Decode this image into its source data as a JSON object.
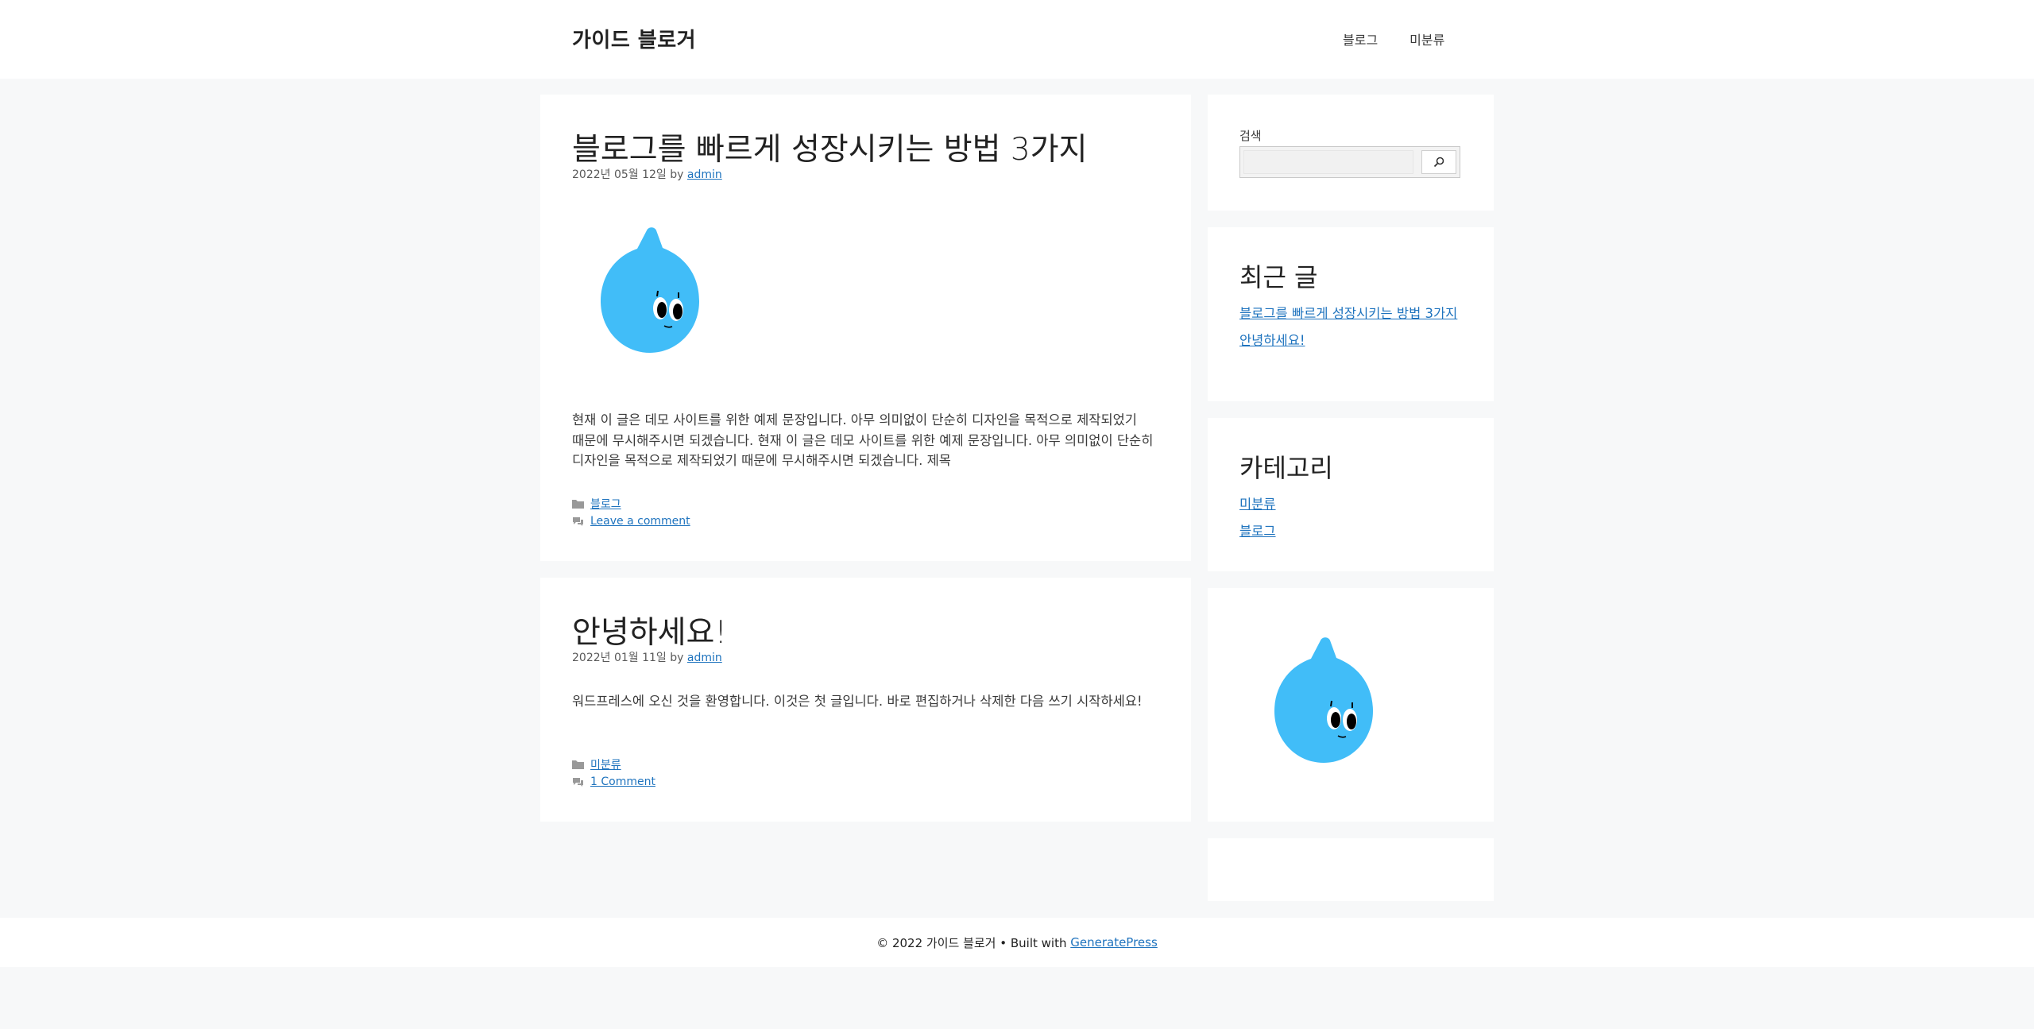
{
  "header": {
    "site_title": "가이드 블로거",
    "nav": [
      "블로그",
      "미분류"
    ]
  },
  "posts": [
    {
      "title": "블로그를 빠르게 성장시키는 방법 3가지",
      "date": "2022년 05월 12일",
      "by": "by",
      "author": "admin",
      "excerpt": "현재 이 글은 데모 사이트를 위한 예제 문장입니다. 아무 의미없이 단순히 디자인을 목적으로 제작되었기 때문에 무시해주시면 되겠습니다. 현재 이 글은 데모 사이트를 위한 예제 문장입니다. 아무 의미없이 단순히 디자인을 목적으로 제작되었기 때문에 무시해주시면 되겠습니다. 제목",
      "category": "블로그",
      "comments": "Leave a comment"
    },
    {
      "title": "안녕하세요!",
      "date": "2022년 01월 11일",
      "by": "by",
      "author": "admin",
      "excerpt": "워드프레스에 오신 것을 환영합니다. 이것은 첫 글입니다. 바로 편집하거나 삭제한 다음 쓰기 시작하세요!",
      "category": "미분류",
      "comments": "1 Comment"
    }
  ],
  "sidebar": {
    "search": {
      "label": "검색",
      "placeholder": ""
    },
    "recent": {
      "title": "최근 글",
      "items": [
        "블로그를 빠르게 성장시키는 방법 3가지",
        "안녕하세요!"
      ]
    },
    "categories": {
      "title": "카테고리",
      "items": [
        "미분류",
        "블로그"
      ]
    }
  },
  "footer": {
    "text": "© 2022 가이드 블로거 • Built with",
    "link": "GeneratePress"
  },
  "colors": {
    "accent": "#1e73be",
    "mascot": "#41bdf8",
    "page_bg": "#f7f8f9"
  }
}
